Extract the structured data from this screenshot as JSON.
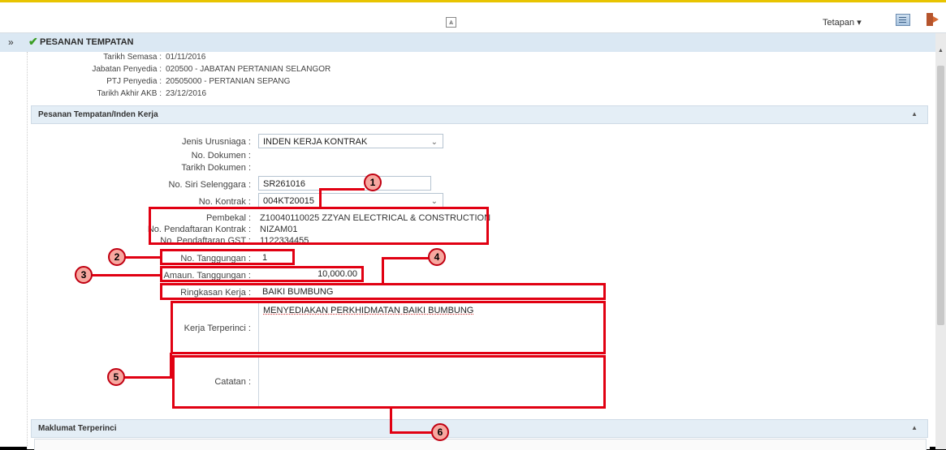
{
  "topbar": {
    "collapse_icon": "⩓",
    "settings_label": "Tetapan ▾"
  },
  "header": {
    "expand_icon": "»",
    "title": "PESANAN TEMPATAN"
  },
  "info": {
    "rows": [
      {
        "label": "Tarikh Semasa :",
        "value": "01/11/2016"
      },
      {
        "label": "Jabatan Penyedia :",
        "value": "020500 - JABATAN PERTANIAN SELANGOR"
      },
      {
        "label": "PTJ Penyedia :",
        "value": "20505000 - PERTANIAN SEPANG"
      },
      {
        "label": "Tarikh Akhir AKB :",
        "value": "23/12/2016"
      }
    ]
  },
  "section1": {
    "title": "Pesanan Tempatan/Inden Kerja",
    "arrow": "▲"
  },
  "form": {
    "jenis_label": "Jenis Urusniaga :",
    "jenis_value": "INDEN KERJA KONTRAK",
    "nodok_label": "No. Dokumen :",
    "tarikhdok_label": "Tarikh Dokumen :",
    "nosiri_label": "No. Siri Selenggara :",
    "nosiri_value": "SR261016",
    "nokontrak_label": "No. Kontrak :",
    "nokontrak_value": "004KT20015",
    "pembekal_label": "Pembekal :",
    "pembekal_value": "Z10040110025 ZZYAN ELECTRICAL & CONSTRUCTION",
    "nopk_label": "No. Pendaftaran Kontrak :",
    "nopk_value": "NIZAM01",
    "nogst_label": "No. Pendaftaran GST :",
    "nogst_value": "1122334455",
    "notang_label": "No. Tanggungan :",
    "notang_value": "1",
    "amaun_label": "Amaun. Tanggungan :",
    "amaun_value": "10,000.00",
    "ringkasan_label": "Ringkasan Kerja :",
    "ringkasan_value": "BAIKI BUMBUNG",
    "kerja_label": "Kerja Terperinci :",
    "kerja_value": "MENYEDIAKAN PERKHIDMATAN BAIKI BUMBUNG",
    "catatan_label": "Catatan :"
  },
  "section2": {
    "title": "Maklumat Terperinci",
    "arrow": "▲"
  },
  "callouts": [
    "1",
    "2",
    "3",
    "4",
    "5",
    "6"
  ],
  "colors": {
    "annotation_red": "#e10012",
    "header_bg": "#dbe8f3"
  }
}
